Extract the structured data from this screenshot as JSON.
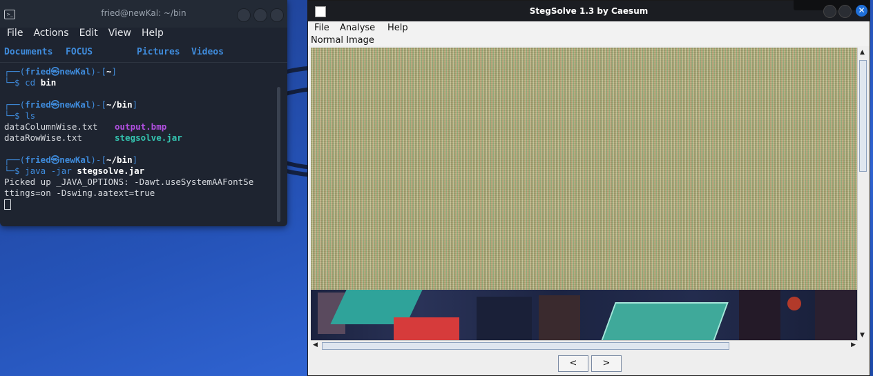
{
  "terminal": {
    "title": "fried@newKal: ~/bin",
    "menu": [
      "File",
      "Actions",
      "Edit",
      "View",
      "Help"
    ],
    "bookmarks": [
      "Documents",
      "FOCUS",
      "Pictures",
      "Videos"
    ],
    "prompt1": {
      "open": "┌──(",
      "user": "fried㉿newKal",
      "mid": ")-[",
      "dir": "~",
      "close": "]",
      "sym": "└─$ ",
      "cmd": "cd",
      "arg": " bin"
    },
    "prompt2": {
      "open": "┌──(",
      "user": "fried㉿newKal",
      "mid": ")-[",
      "dir": "~/bin",
      "close": "]",
      "sym": "└─$ ",
      "cmd": "ls"
    },
    "ls_output": {
      "col1": [
        "dataColumnWise.txt",
        "dataRowWise.txt"
      ],
      "col2": [
        "output.bmp",
        "stegsolve.jar"
      ]
    },
    "prompt3": {
      "open": "┌──(",
      "user": "fried㉿newKal",
      "mid": ")-[",
      "dir": "~/bin",
      "close": "]",
      "sym": "└─$ ",
      "cmd": "java -jar",
      "arg": " stegsolve.jar"
    },
    "output_lines": [
      "Picked up _JAVA_OPTIONS: -Dawt.useSystemAAFontSe",
      "ttings=on -Dswing.aatext=true"
    ]
  },
  "stegsolve": {
    "title": "StegSolve 1.3 by Caesum",
    "menu": [
      "File",
      "Analyse",
      "Help"
    ],
    "view_label": "Normal Image",
    "prev_label": "<",
    "next_label": ">",
    "close_glyph": "✕"
  }
}
